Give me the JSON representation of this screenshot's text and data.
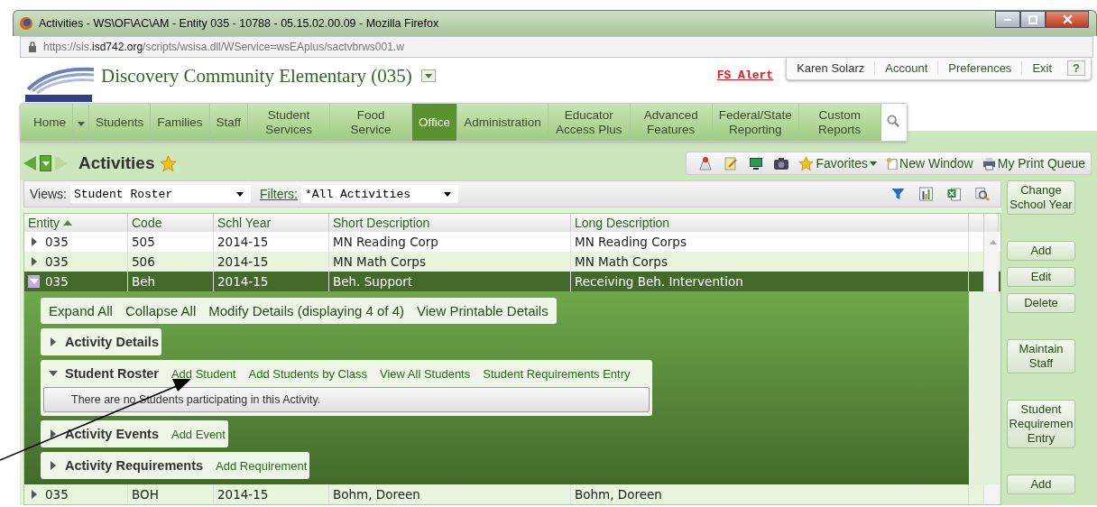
{
  "window": {
    "title": "Activities - WS\\OF\\AC\\AM - Entity 035 - 10788 - 05.15.02.00.09 - Mozilla Firefox"
  },
  "address_bar": {
    "url_start": "https://sis.",
    "url_domain": "isd742.org",
    "url_end": "/scripts/wsisa.dll/WService=wsEAplus/sactvbrws001.w"
  },
  "school": {
    "name": "Discovery Community Elementary (035)"
  },
  "fs_alert": "FS Alert",
  "user_menu": [
    {
      "label": "Karen Solarz"
    },
    {
      "label": "Account"
    },
    {
      "label": "Preferences"
    },
    {
      "label": "Exit"
    },
    {
      "label": "?",
      "kind": "help"
    }
  ],
  "nav_tabs": [
    {
      "label": "Home",
      "selected": false,
      "dropdown": true
    },
    {
      "label": "Students",
      "selected": false
    },
    {
      "label": "Families",
      "selected": false
    },
    {
      "label": "Staff",
      "selected": false
    },
    {
      "label": "Student Services",
      "selected": false
    },
    {
      "label": "Food Service",
      "selected": false
    },
    {
      "label": "Office",
      "selected": true
    },
    {
      "label": "Administration",
      "selected": false
    },
    {
      "label": "Educator Access Plus",
      "selected": false
    },
    {
      "label": "Advanced Features",
      "selected": false
    },
    {
      "label": "Federal/State Reporting",
      "selected": false
    },
    {
      "label": "Custom Reports",
      "selected": false
    }
  ],
  "page_title": "Activities",
  "toolbar": {
    "favorites": "Favorites",
    "new_window": "New Window",
    "print_queue": "My Print Queue"
  },
  "views": {
    "label": "Views:",
    "value": "Student Roster"
  },
  "filters": {
    "label": "Filters:",
    "value": "*All Activities"
  },
  "table": {
    "columns": [
      "Entity",
      "Code",
      "Schl Year",
      "Short Description",
      "Long Description"
    ],
    "rows": [
      {
        "cells": [
          "035",
          "505",
          "2014-15",
          "MN Reading Corp",
          "MN Reading Corps"
        ],
        "expanded": false,
        "selected": false
      },
      {
        "cells": [
          "035",
          "506",
          "2014-15",
          "MN Math Corps",
          "MN Math Corps"
        ],
        "expanded": false,
        "selected": false
      },
      {
        "cells": [
          "035",
          "Beh",
          "2014-15",
          "Beh. Support",
          "Receiving Beh. Intervention"
        ],
        "expanded": true,
        "selected": true
      },
      {
        "cells": [
          "035",
          "BOH",
          "2014-15",
          "Bohm, Doreen",
          "Bohm, Doreen"
        ],
        "expanded": false,
        "selected": false
      }
    ]
  },
  "details": {
    "actions": [
      "Expand All",
      "Collapse All",
      "Modify Details (displaying 4 of 4)",
      "View Printable Details"
    ],
    "sections": [
      {
        "title": "Activity Details",
        "expanded": false
      },
      {
        "title": "Student Roster",
        "expanded": true,
        "links": [
          "Add Student",
          "Add Students by Class",
          "View All Students",
          "Student Requirements Entry"
        ],
        "message": "There are no Students participating in this Activity."
      },
      {
        "title": "Activity Events",
        "expanded": false,
        "links": [
          "Add Event"
        ]
      },
      {
        "title": "Activity Requirements",
        "expanded": false,
        "links": [
          "Add Requirement"
        ]
      }
    ]
  },
  "side_buttons": [
    {
      "label": "Change School Year"
    },
    {
      "label": "Add"
    },
    {
      "label": "Edit"
    },
    {
      "label": "Delete"
    },
    {
      "label": "Maintain Staff"
    },
    {
      "label": "Student Requiremen Entry"
    },
    {
      "label": "Add"
    }
  ]
}
